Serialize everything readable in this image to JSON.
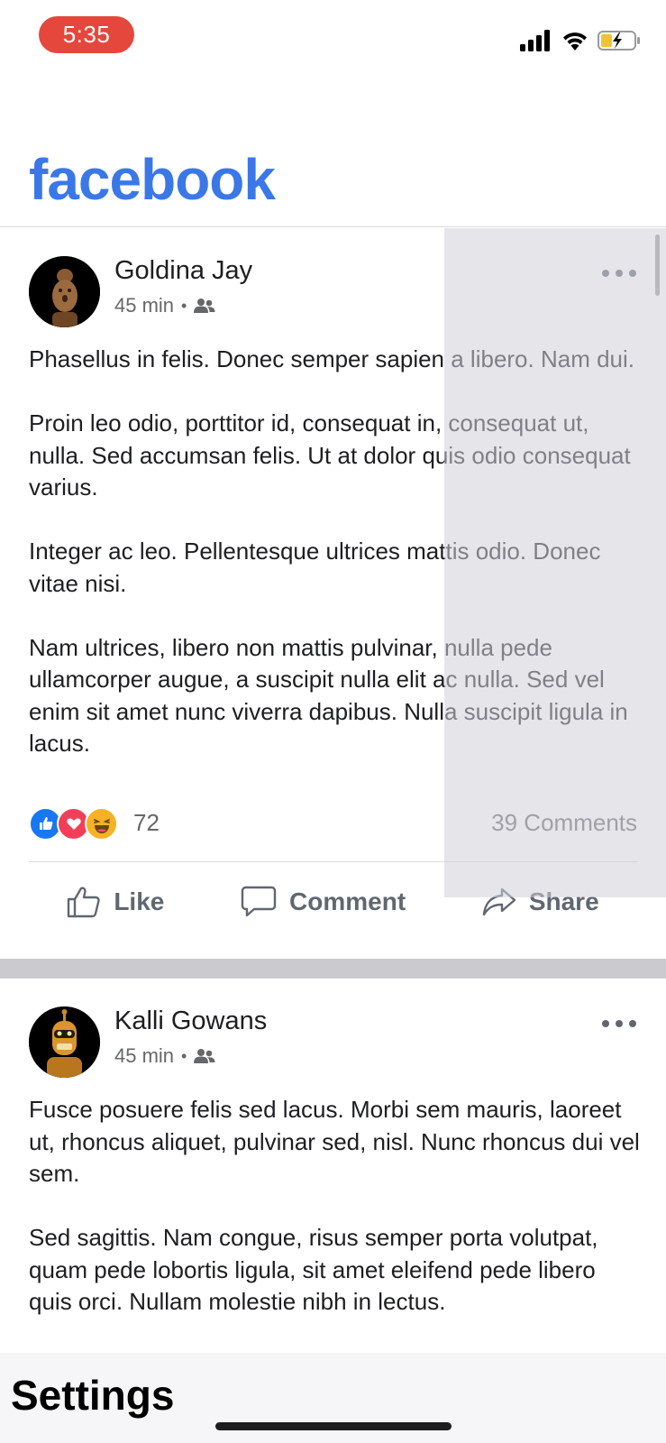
{
  "status_bar": {
    "time": "5:35",
    "icons": [
      "cellular-signal-icon",
      "wifi-icon",
      "battery-charging-icon"
    ]
  },
  "header": {
    "logo_text": "facebook",
    "brand_color": "#3b78e7"
  },
  "posts": [
    {
      "author": "Goldina Jay",
      "time": "45 min",
      "audience_icon": "friends-icon",
      "paragraphs": [
        "Phasellus in felis. Donec semper sapien a libero. Nam dui.",
        "Proin leo odio, porttitor id, consequat in, consequat ut, nulla. Sed accumsan felis. Ut at dolor quis odio consequat varius.",
        "Integer ac leo. Pellentesque ultrices mattis odio. Donec vitae nisi.",
        "Nam ultrices, libero non mattis pulvinar, nulla pede ullamcorper augue, a suscipit nulla elit ac nulla. Sed vel enim sit amet nunc viverra dapibus. Nulla suscipit ligula in lacus."
      ],
      "reactions": [
        "like-reaction-icon",
        "love-reaction-icon",
        "haha-reaction-icon"
      ],
      "reaction_count": "72",
      "comments_count": "39 Comments",
      "actions": {
        "like": "Like",
        "comment": "Comment",
        "share": "Share"
      }
    },
    {
      "author": "Kalli Gowans",
      "time": "45 min",
      "audience_icon": "friends-icon",
      "paragraphs": [
        "Fusce posuere felis sed lacus. Morbi sem mauris, laoreet ut, rhoncus aliquet, pulvinar sed, nisl. Nunc rhoncus dui vel sem.",
        "Sed sagittis. Nam congue, risus semper porta volutpat, quam pede lobortis ligula, sit amet eleifend pede libero quis orci. Nullam molestie nibh in lectus."
      ]
    }
  ],
  "bottom_bar": {
    "title": "Settings"
  }
}
